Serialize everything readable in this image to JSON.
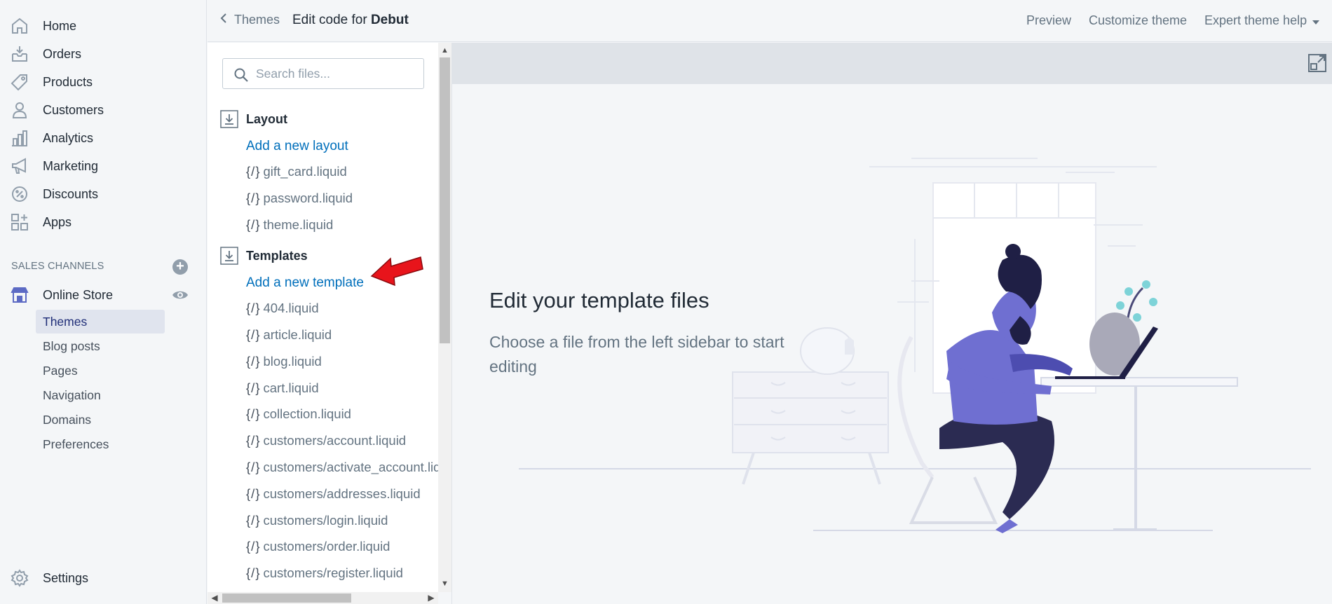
{
  "nav": {
    "items": [
      {
        "label": "Home",
        "icon": "home-icon"
      },
      {
        "label": "Orders",
        "icon": "orders-icon"
      },
      {
        "label": "Products",
        "icon": "tag-icon"
      },
      {
        "label": "Customers",
        "icon": "person-icon"
      },
      {
        "label": "Analytics",
        "icon": "bar-chart-icon"
      },
      {
        "label": "Marketing",
        "icon": "megaphone-icon"
      },
      {
        "label": "Discounts",
        "icon": "discount-icon"
      },
      {
        "label": "Apps",
        "icon": "apps-icon"
      }
    ],
    "channels_heading": "SALES CHANNELS",
    "online_store": "Online Store",
    "sub_items": [
      "Themes",
      "Blog posts",
      "Pages",
      "Navigation",
      "Domains",
      "Preferences"
    ],
    "active_sub_item": "Themes",
    "settings": "Settings"
  },
  "topbar": {
    "back_label": "Themes",
    "title_prefix": "Edit code for",
    "theme_name": "Debut",
    "preview": "Preview",
    "customize": "Customize theme",
    "expert_help": "Expert theme help"
  },
  "files": {
    "search_placeholder": "Search files...",
    "layout_folder": "Layout",
    "add_layout": "Add a new layout",
    "layout_files": [
      "gift_card.liquid",
      "password.liquid",
      "theme.liquid"
    ],
    "templates_folder": "Templates",
    "add_template": "Add a new template",
    "template_files": [
      "404.liquid",
      "article.liquid",
      "blog.liquid",
      "cart.liquid",
      "collection.liquid",
      "customers/account.liquid",
      "customers/activate_account.liquid",
      "customers/addresses.liquid",
      "customers/login.liquid",
      "customers/order.liquid",
      "customers/register.liquid"
    ],
    "file_icon_glyph": "{/}"
  },
  "editor": {
    "empty_title": "Edit your template files",
    "empty_description": "Choose a file from the left sidebar to start editing"
  },
  "colors": {
    "link": "#006fbb",
    "active_nav_bg": "#e0e4ee",
    "annotation_arrow": "#e8141b",
    "illustration_purple": "#6f6fd1",
    "illustration_navy": "#1f1f45"
  }
}
